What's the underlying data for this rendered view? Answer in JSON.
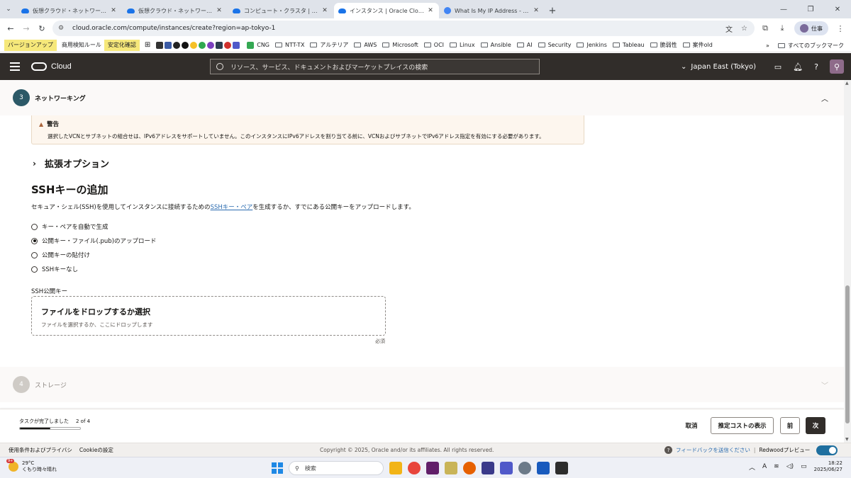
{
  "browser": {
    "tabs": [
      {
        "title": "仮想クラウド・ネットワーク | Oracle Cl",
        "active": false,
        "favicon": "cloud-icon"
      },
      {
        "title": "仮想クラウド・ネットワーク | Oracle Cl",
        "active": false,
        "favicon": "cloud-icon"
      },
      {
        "title": "コンピュート・クラスタ | Oracle Cloud",
        "active": false,
        "favicon": "cloud-icon"
      },
      {
        "title": "インスタンス | Oracle Cloud Infras",
        "active": true,
        "favicon": "cloud-icon"
      },
      {
        "title": "What Is My IP Address - See Yo",
        "active": false,
        "favicon": "globe-icon"
      }
    ],
    "url": "cloud.oracle.com/compute/instances/create?region=ap-tokyo-1",
    "profile_label": "仕事",
    "bookmarks": [
      {
        "label": "バージョンアップ",
        "type": "highlight"
      },
      {
        "label": "商用検知ルール",
        "type": "plain"
      },
      {
        "label": "安定化確認",
        "type": "highlight"
      },
      {
        "label": "CNG",
        "type": "folder"
      },
      {
        "label": "NTT-TX",
        "type": "folder"
      },
      {
        "label": "アルテリア",
        "type": "folder"
      },
      {
        "label": "AWS",
        "type": "folder"
      },
      {
        "label": "Microsoft",
        "type": "folder"
      },
      {
        "label": "OCI",
        "type": "folder"
      },
      {
        "label": "Linux",
        "type": "folder"
      },
      {
        "label": "Ansible",
        "type": "folder"
      },
      {
        "label": "AI",
        "type": "folder"
      },
      {
        "label": "Security",
        "type": "folder"
      },
      {
        "label": "Jenkins",
        "type": "folder"
      },
      {
        "label": "Tableau",
        "type": "folder"
      },
      {
        "label": "脆弱性",
        "type": "folder"
      },
      {
        "label": "案件old",
        "type": "folder"
      }
    ],
    "all_bookmarks": "すべてのブックマーク"
  },
  "header": {
    "brand": "Cloud",
    "search_placeholder": "リソース、サービス、ドキュメントおよびマーケットプレイスの検索",
    "region": "Japan East (Tokyo)"
  },
  "step3": {
    "number": "3",
    "title": "ネットワーキング"
  },
  "warning": {
    "title": "警告",
    "message": "選択したVCNとサブネットの組合せは、IPv6アドレスをサポートしていません。このインスタンスにIPv6アドレスを割り当てる前に、VCNおよびサブネットでIPv6アドレス指定を有効にする必要があります。"
  },
  "advanced_options": "拡張オプション",
  "ssh": {
    "title": "SSHキーの追加",
    "desc_before": "セキュア・シェル(SSH)を使用してインスタンスに接続するための",
    "desc_link": "SSHキー・ペア",
    "desc_after": "を生成するか、すでにある公開キーをアップロードします。",
    "options": [
      {
        "label": "キー・ペアを自動で生成",
        "selected": false
      },
      {
        "label": "公開キー・ファイル(.pub)のアップロード",
        "selected": true
      },
      {
        "label": "公開キーの貼付け",
        "selected": false
      },
      {
        "label": "SSHキーなし",
        "selected": false
      }
    ],
    "public_key_label": "SSH公開キー",
    "drop_title": "ファイルをドロップするか選択",
    "drop_sub": "ファイルを選択するか、ここにドロップします",
    "required": "必須"
  },
  "step4": {
    "number": "4",
    "title": "ストレージ"
  },
  "footer": {
    "progress_label": "タスクが完了しました",
    "progress_count": "2 of 4",
    "progress_fraction": 0.5,
    "cancel": "取消",
    "estimate": "推定コストの表示",
    "prev": "前",
    "next": "次"
  },
  "page_footer": {
    "terms": "使用条件およびプライバシ",
    "cookies": "Cookieの設定",
    "copyright": "Copyright © 2025, Oracle and/or its affiliates. All rights reserved.",
    "feedback": "フィードバックを送信ください",
    "redwood": "Redwoodプレビュー"
  },
  "taskbar": {
    "temp": "29°C",
    "weather": "くもり時々晴れ",
    "badge": "9+",
    "search": "検索",
    "time": "18:22",
    "date": "2025/06/27"
  }
}
